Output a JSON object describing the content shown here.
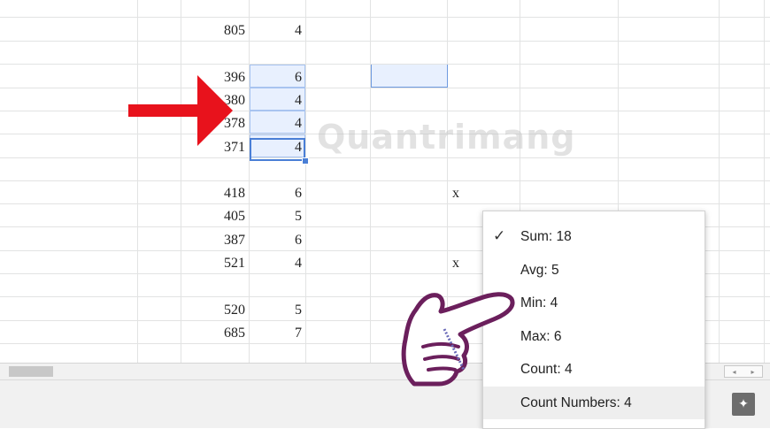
{
  "rows": [
    {
      "a": "805",
      "b": "4",
      "x": ""
    },
    {
      "a": "",
      "b": "",
      "x": ""
    },
    {
      "a": "396",
      "b": "6",
      "x": ""
    },
    {
      "a": "380",
      "b": "4",
      "x": ""
    },
    {
      "a": "378",
      "b": "4",
      "x": ""
    },
    {
      "a": "371",
      "b": "4",
      "x": ""
    },
    {
      "a": "",
      "b": "",
      "x": ""
    },
    {
      "a": "418",
      "b": "6",
      "x": "x"
    },
    {
      "a": "405",
      "b": "5",
      "x": ""
    },
    {
      "a": "387",
      "b": "6",
      "x": ""
    },
    {
      "a": "521",
      "b": "4",
      "x": "x"
    },
    {
      "a": "",
      "b": "",
      "x": ""
    },
    {
      "a": "520",
      "b": "5",
      "x": ""
    },
    {
      "a": "685",
      "b": "7",
      "x": ""
    }
  ],
  "menu": {
    "items": [
      {
        "label": "Sum: 18",
        "checked": true
      },
      {
        "label": "Avg: 5",
        "checked": false
      },
      {
        "label": "Min: 4",
        "checked": false
      },
      {
        "label": "Max: 6",
        "checked": false
      },
      {
        "label": "Count: 4",
        "checked": false
      },
      {
        "label": "Count Numbers: 4",
        "checked": false
      }
    ],
    "check_glyph": "✓"
  },
  "watermark": "Quantrimang",
  "icons": {
    "explore": "explore-icon",
    "scroll_left": "◂",
    "scroll_right": "▸"
  },
  "colors": {
    "selection": "#e8f0fe",
    "accent": "#4a7fd6",
    "arrow": "#e8121c",
    "hand": "#6b1f5c"
  }
}
